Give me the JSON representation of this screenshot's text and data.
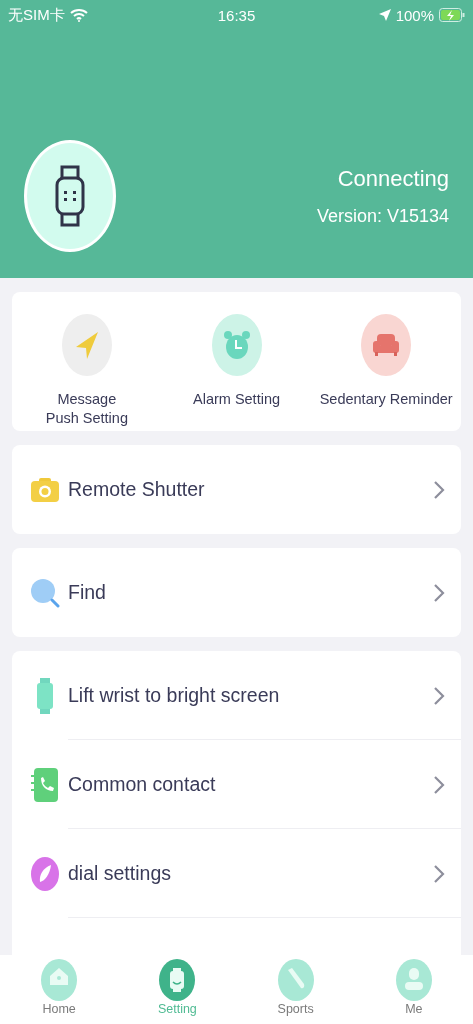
{
  "status_bar": {
    "carrier": "无SIM卡",
    "time": "16:35",
    "battery": "100%",
    "charging": true
  },
  "device": {
    "status": "Connecting",
    "version": "Version: V15134"
  },
  "shortcuts": [
    {
      "kind": "message",
      "label": "Message\nPush Setting"
    },
    {
      "kind": "alarm",
      "label": "Alarm Setting"
    },
    {
      "kind": "sedentary",
      "label": "Sedentary Reminder"
    }
  ],
  "groups": [
    [
      {
        "kind": "camera",
        "label": "Remote Shutter"
      }
    ],
    [
      {
        "kind": "find",
        "label": "Find"
      }
    ],
    [
      {
        "kind": "wrist",
        "label": "Lift wrist to bright screen"
      },
      {
        "kind": "contact",
        "label": "Common contact"
      },
      {
        "kind": "dial",
        "label": "dial settings"
      }
    ]
  ],
  "tabs": [
    {
      "kind": "home",
      "label": "Home",
      "selected": false
    },
    {
      "kind": "setting",
      "label": "Setting",
      "selected": true
    },
    {
      "kind": "sports",
      "label": "Sports",
      "selected": false
    },
    {
      "kind": "me",
      "label": "Me",
      "selected": false
    }
  ]
}
